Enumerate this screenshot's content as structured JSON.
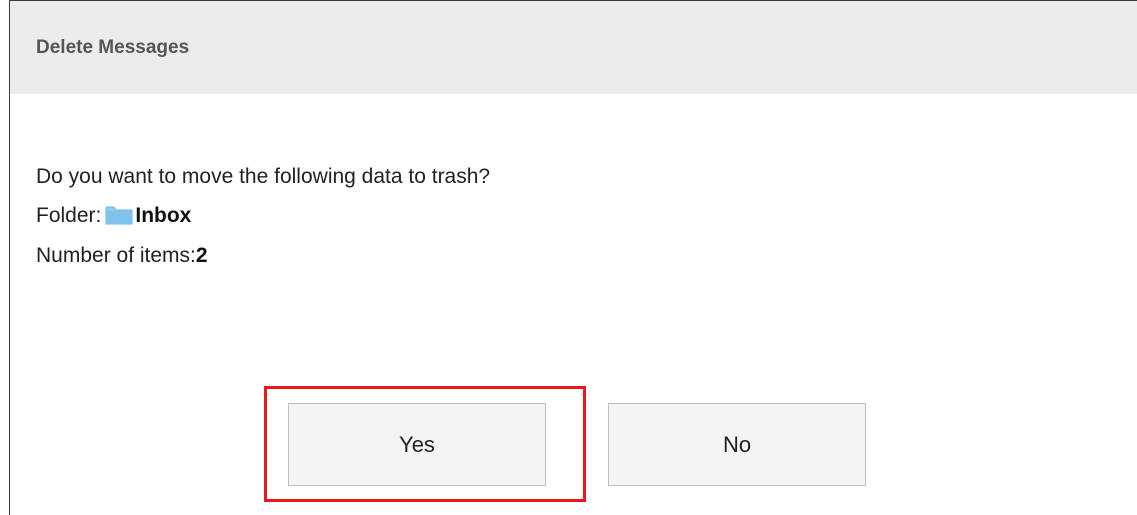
{
  "dialog": {
    "title": "Delete Messages",
    "question": "Do you want to move the following data to trash?",
    "folder_label": "Folder:",
    "folder_name": "Inbox",
    "items_label": "Number of items:",
    "items_count": "2",
    "folder_icon": "folder-icon",
    "folder_icon_color": "#7ec3ee"
  },
  "buttons": {
    "yes_label": "Yes",
    "no_label": "No"
  },
  "highlight": {
    "color": "#e8191d",
    "target": "yes-button"
  }
}
